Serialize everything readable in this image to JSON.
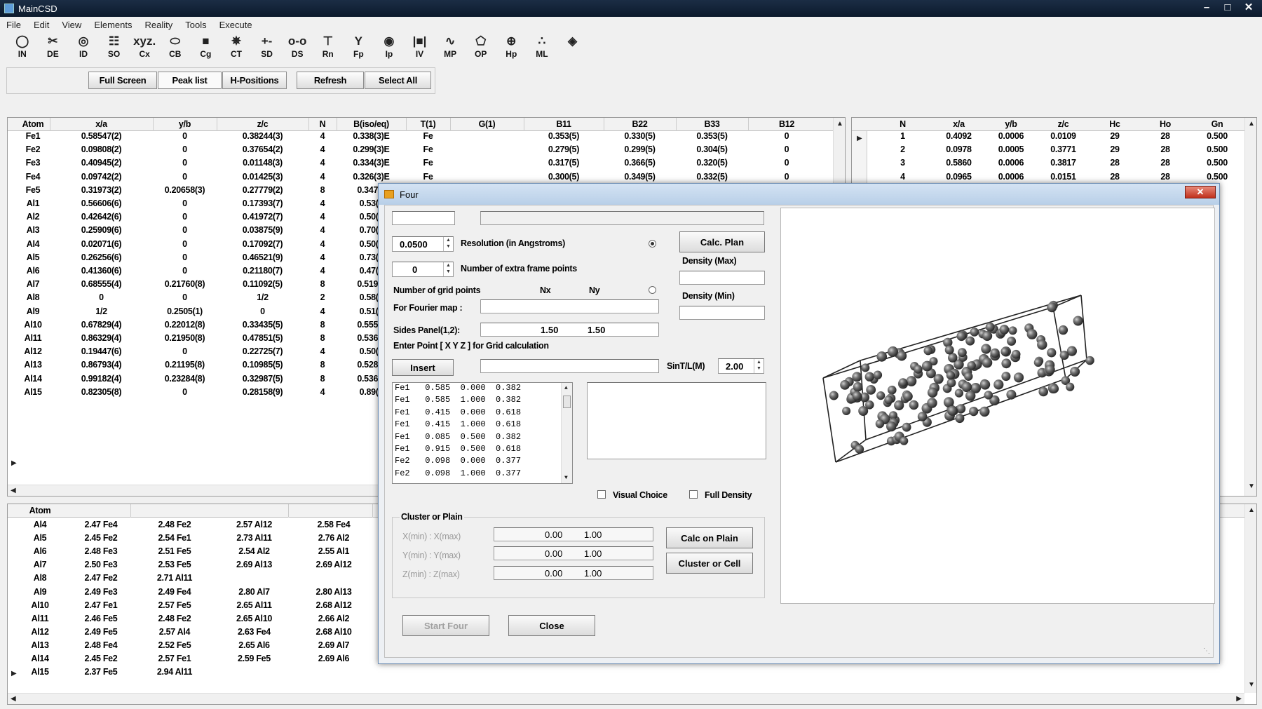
{
  "window": {
    "title": "MainCSD",
    "min": "–",
    "max": "□",
    "close": "✕"
  },
  "menu": [
    "File",
    "Edit",
    "View",
    "Elements",
    "Reality",
    "Tools",
    "Execute"
  ],
  "toolbar": [
    {
      "label": "IN",
      "icon": "circle-icon",
      "glyph": "◯"
    },
    {
      "label": "DE",
      "icon": "scissors-icon",
      "glyph": "✂"
    },
    {
      "label": "ID",
      "icon": "target-icon",
      "glyph": "◎"
    },
    {
      "label": "SO",
      "icon": "grid-icon",
      "glyph": "☷"
    },
    {
      "label": "Cx",
      "icon": "xyz-icon",
      "glyph": "xyz."
    },
    {
      "label": "CB",
      "icon": "ellipse-icon",
      "glyph": "⬭"
    },
    {
      "label": "Cg",
      "icon": "stack-icon",
      "glyph": "■"
    },
    {
      "label": "CT",
      "icon": "cluster-icon",
      "glyph": "✵"
    },
    {
      "label": "SD",
      "icon": "plus-dots-icon",
      "glyph": "+-"
    },
    {
      "label": "DS",
      "icon": "chain-icon",
      "glyph": "o-o"
    },
    {
      "label": "Rn",
      "icon": "branch-icon",
      "glyph": "⊤"
    },
    {
      "label": "Fp",
      "icon": "fork-icon",
      "glyph": "Y"
    },
    {
      "label": "Ip",
      "icon": "eye-icon",
      "glyph": "◉"
    },
    {
      "label": "IV",
      "icon": "bars-icon",
      "glyph": "|■|"
    },
    {
      "label": "MP",
      "icon": "wave-icon",
      "glyph": "∿"
    },
    {
      "label": "OP",
      "icon": "polygon-icon",
      "glyph": "⬠"
    },
    {
      "label": "Hp",
      "icon": "crosshair-icon",
      "glyph": "⊕"
    },
    {
      "label": "ML",
      "icon": "molecule-icon",
      "glyph": "∴"
    },
    {
      "label": "",
      "icon": "layer-icon",
      "glyph": "◈"
    }
  ],
  "buttons": {
    "full_screen": "Full Screen",
    "peak_list": "Peak list",
    "h_positions": "H-Positions",
    "refresh": "Refresh",
    "select_all": "Select All"
  },
  "atom_table": {
    "headers": [
      "Atom",
      "x/a",
      "y/b",
      "z/c",
      "N",
      "B(iso/eq)",
      "T(1)",
      "G(1)",
      "B11",
      "B22",
      "B33",
      "B12"
    ],
    "rows": [
      [
        "Fe1",
        "0.58547(2)",
        "0",
        "0.38244(3)",
        "4",
        "0.338(3)E",
        "Fe",
        "",
        "0.353(5)",
        "0.330(5)",
        "0.353(5)",
        "0"
      ],
      [
        "Fe2",
        "0.09808(2)",
        "0",
        "0.37654(2)",
        "4",
        "0.299(3)E",
        "Fe",
        "",
        "0.279(5)",
        "0.299(5)",
        "0.304(5)",
        "0"
      ],
      [
        "Fe3",
        "0.40945(2)",
        "0",
        "0.01148(3)",
        "4",
        "0.334(3)E",
        "Fe",
        "",
        "0.317(5)",
        "0.366(5)",
        "0.320(5)",
        "0"
      ],
      [
        "Fe4",
        "0.09742(2)",
        "0",
        "0.01425(3)",
        "4",
        "0.326(3)E",
        "Fe",
        "",
        "0.300(5)",
        "0.349(5)",
        "0.332(5)",
        "0"
      ],
      [
        "Fe5",
        "0.31973(2)",
        "0.20658(3)",
        "0.27779(2)",
        "8",
        "0.347(2",
        "",
        "",
        "",
        "",
        "",
        ""
      ],
      [
        "Al1",
        "0.56606(6)",
        "0",
        "0.17393(7)",
        "4",
        "0.53(1",
        "",
        "",
        "",
        "",
        "",
        ""
      ],
      [
        "Al2",
        "0.42642(6)",
        "0",
        "0.41972(7)",
        "4",
        "0.50(1",
        "",
        "",
        "",
        "",
        "",
        ""
      ],
      [
        "Al3",
        "0.25909(6)",
        "0",
        "0.03875(9)",
        "4",
        "0.70(2",
        "",
        "",
        "",
        "",
        "",
        ""
      ],
      [
        "Al4",
        "0.02071(6)",
        "0",
        "0.17092(7)",
        "4",
        "0.50(1",
        "",
        "",
        "",
        "",
        "",
        ""
      ],
      [
        "Al5",
        "0.26256(6)",
        "0",
        "0.46521(9)",
        "4",
        "0.73(2",
        "",
        "",
        "",
        "",
        "",
        ""
      ],
      [
        "Al6",
        "0.41360(6)",
        "0",
        "0.21180(7)",
        "4",
        "0.47(1",
        "",
        "",
        "",
        "",
        "",
        ""
      ],
      [
        "Al7",
        "0.68555(4)",
        "0.21760(8)",
        "0.11092(5)",
        "8",
        "0.519(8",
        "",
        "",
        "",
        "",
        "",
        ""
      ],
      [
        "Al8",
        "0",
        "0",
        "1/2",
        "2",
        "0.58(2",
        "",
        "",
        "",
        "",
        "",
        ""
      ],
      [
        "Al9",
        "1/2",
        "0.2505(1)",
        "0",
        "4",
        "0.51(1",
        "",
        "",
        "",
        "",
        "",
        ""
      ],
      [
        "Al10",
        "0.67829(4)",
        "0.22012(8)",
        "0.33435(5)",
        "8",
        "0.555(8",
        "",
        "",
        "",
        "",
        "",
        ""
      ],
      [
        "Al11",
        "0.86329(4)",
        "0.21950(8)",
        "0.47851(5)",
        "8",
        "0.536(8",
        "",
        "",
        "",
        "",
        "",
        ""
      ],
      [
        "Al12",
        "0.19447(6)",
        "0",
        "0.22725(7)",
        "4",
        "0.50(1",
        "",
        "",
        "",
        "",
        "",
        ""
      ],
      [
        "Al13",
        "0.86793(4)",
        "0.21195(8)",
        "0.10985(5)",
        "8",
        "0.528(8",
        "",
        "",
        "",
        "",
        "",
        ""
      ],
      [
        "Al14",
        "0.99182(4)",
        "0.23284(8)",
        "0.32987(5)",
        "8",
        "0.536(8",
        "",
        "",
        "",
        "",
        "",
        ""
      ],
      [
        "Al15",
        "0.82305(8)",
        "0",
        "0.28158(9)",
        "4",
        "0.89(2",
        "",
        "",
        "",
        "",
        "",
        ""
      ]
    ]
  },
  "peak_table": {
    "headers": [
      "N",
      "x/a",
      "y/b",
      "z/c",
      "Hc",
      "Ho",
      "Gn"
    ],
    "rows": [
      [
        "1",
        "0.4092",
        "0.0006",
        "0.0109",
        "29",
        "28",
        "0.500"
      ],
      [
        "2",
        "0.0978",
        "0.0005",
        "0.3771",
        "29",
        "28",
        "0.500"
      ],
      [
        "3",
        "0.5860",
        "0.0006",
        "0.3817",
        "28",
        "28",
        "0.500"
      ],
      [
        "4",
        "0.0965",
        "0.0006",
        "0.0151",
        "28",
        "28",
        "0.500"
      ]
    ]
  },
  "distance_table": {
    "headers": [
      "Atom"
    ],
    "rows": [
      [
        "Al4",
        "2.47 Fe4",
        "2.48 Fe2",
        "2.57 Al12",
        "2.58 Fe4"
      ],
      [
        "Al5",
        "2.45 Fe2",
        "2.54 Fe1",
        "2.73 Al11",
        "2.76 Al2"
      ],
      [
        "Al6",
        "2.48 Fe3",
        "2.51 Fe5",
        "2.54 Al2",
        "2.55 Al1"
      ],
      [
        "Al7",
        "2.50 Fe3",
        "2.53 Fe5",
        "2.69 Al13",
        "2.69 Al12"
      ],
      [
        "Al8",
        "2.47 Fe2",
        "2.71 Al11",
        "",
        ""
      ],
      [
        "Al9",
        "2.49 Fe3",
        "2.49 Fe4",
        "2.80 Al7",
        "2.80 Al13"
      ],
      [
        "Al10",
        "2.47 Fe1",
        "2.57 Fe5",
        "2.65 Al11",
        "2.68 Al12"
      ],
      [
        "Al11",
        "2.46 Fe5",
        "2.48 Fe2",
        "2.65 Al10",
        "2.66 Al2"
      ],
      [
        "Al12",
        "2.49 Fe5",
        "2.57 Al4",
        "2.63 Fe4",
        "2.68 Al10"
      ],
      [
        "Al13",
        "2.48 Fe4",
        "2.52 Fe5",
        "2.65 Al6",
        "2.69 Al7"
      ],
      [
        "Al14",
        "2.45 Fe2",
        "2.57 Fe1",
        "2.59 Fe5",
        "2.69 Al6"
      ],
      [
        "Al15",
        "2.37 Fe5",
        "2.94 Al11",
        "",
        ""
      ]
    ]
  },
  "dialog": {
    "title": "Four",
    "close": "✕",
    "resolution_value": "0.0500",
    "resolution_label": "Resolution (in Angstroms)",
    "frame_value": "0",
    "frame_label": "Number of extra frame points",
    "grid_label": "Number of grid points",
    "nx": "Nx",
    "ny": "Ny",
    "fourier_label": "For Fourier map :",
    "sides_label": "Sides Panel(1,2):",
    "sides_v1": "1.50",
    "sides_v2": "1.50",
    "enter_point_label": "Enter Point [ X Y Z ] for Grid calculation",
    "insert": "Insert",
    "sint_label": "SinT/L(M)",
    "sint_value": "2.00",
    "calc_plan": "Calc. Plan",
    "density_max": "Density (Max)",
    "density_min": "Density (Min)",
    "points": [
      "Fe1   0.585  0.000  0.382",
      "Fe1   0.585  1.000  0.382",
      "Fe1   0.415  0.000  0.618",
      "Fe1   0.415  1.000  0.618",
      "Fe1   0.085  0.500  0.382",
      "Fe1   0.915  0.500  0.618",
      "Fe2   0.098  0.000  0.377",
      "Fe2   0.098  1.000  0.377"
    ],
    "visual_choice": "Visual Choice",
    "full_density": "Full Density",
    "cluster_title": "Cluster or Plain",
    "xrange_label": "X(min) : X(max)",
    "yrange_label": "Y(min) : Y(max)",
    "zrange_label": "Z(min) : Z(max)",
    "min_value": "0.00",
    "max_value": "1.00",
    "calc_on_plain": "Calc on Plain",
    "cluster_or_cell": "Cluster or Cell",
    "start_four": "Start Four",
    "close_btn": "Close"
  }
}
